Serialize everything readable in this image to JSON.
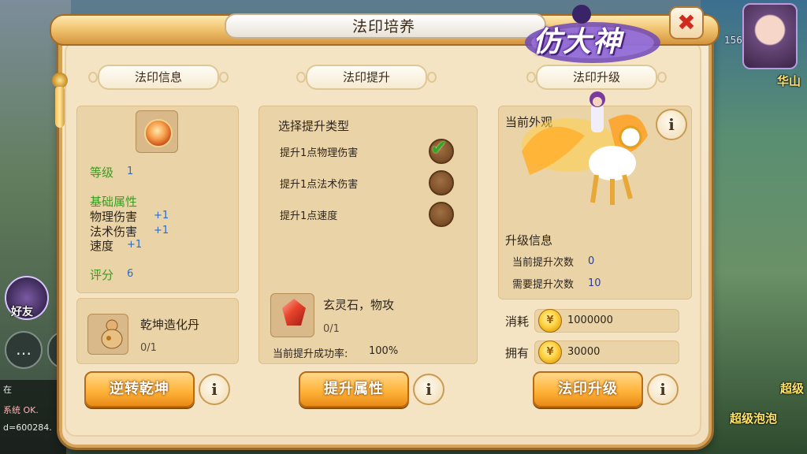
{
  "window": {
    "title": "法印培养",
    "logo_text": "仿大神"
  },
  "background": {
    "chat_lines": [
      "在",
      "系统 OK.",
      "d=600284."
    ],
    "friend_label": "好友",
    "right_labels": [
      "华山",
      "超级",
      "超级泡泡"
    ],
    "right_number": "156"
  },
  "sections": {
    "info_header": "法印信息",
    "upgrade_header": "法印提升",
    "levelup_header": "法印升级"
  },
  "info": {
    "level_label": "等级",
    "level_value": "1",
    "base_attr_label": "基础属性",
    "attrs": [
      {
        "name": "物理伤害",
        "value": "+1"
      },
      {
        "name": "法术伤害",
        "value": "+1"
      },
      {
        "name": "速度",
        "value": "+1"
      }
    ],
    "score_label": "评分",
    "score_value": "6",
    "item_name": "乾坤造化丹",
    "item_count": "0/1",
    "button": "逆转乾坤"
  },
  "upgrade": {
    "prompt": "选择提升类型",
    "options": [
      {
        "label": "提升1点物理伤害",
        "selected": true
      },
      {
        "label": "提升1点法术伤害",
        "selected": false
      },
      {
        "label": "提升1点速度",
        "selected": false
      }
    ],
    "material_name": "玄灵石，物攻",
    "material_count": "0/1",
    "success_rate_label": "当前提升成功率:",
    "success_rate_value": "100%",
    "button": "提升属性"
  },
  "levelup": {
    "appearance_label": "当前外观",
    "upgrade_info_label": "升级信息",
    "current_count_label": "当前提升次数",
    "current_count_value": "0",
    "required_count_label": "需要提升次数",
    "required_count_value": "10",
    "cost_label": "消耗",
    "cost_value": "1000000",
    "own_label": "拥有",
    "own_value": "30000",
    "button": "法印升级"
  },
  "icons": {
    "close": "✖",
    "info": "i",
    "check": "✔",
    "coin": "¥"
  },
  "colors": {
    "accent_green": "#3f9a22",
    "value_blue": "#2b6bc7",
    "button_orange": "#ffb43b"
  }
}
